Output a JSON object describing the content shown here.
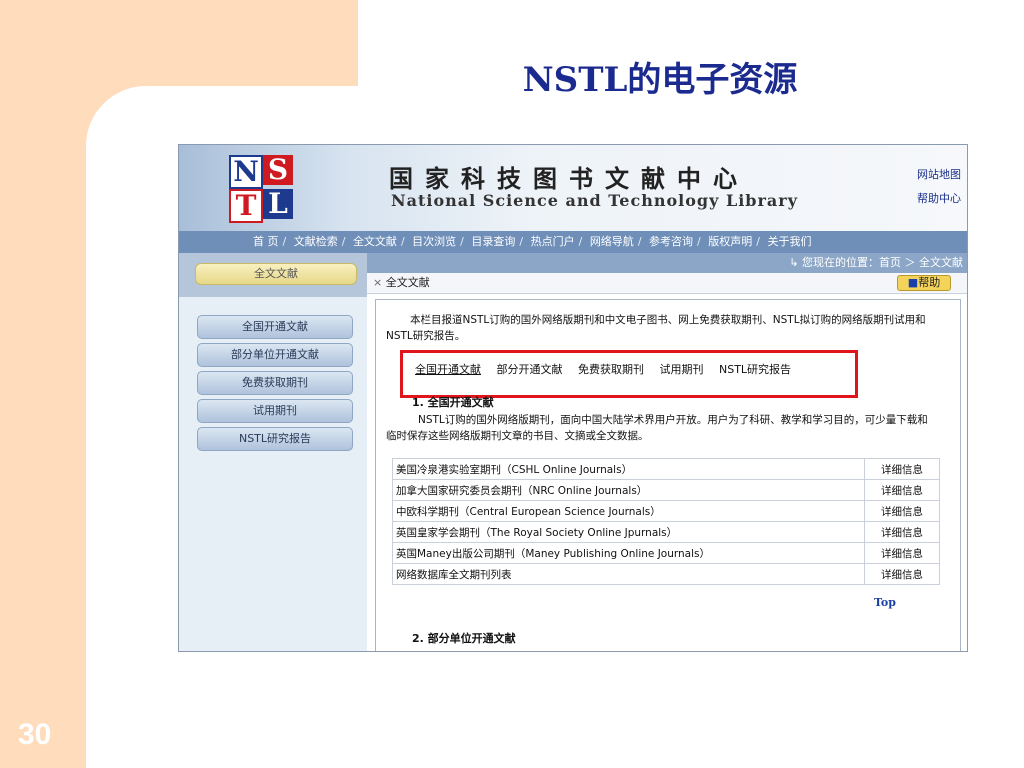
{
  "slide": {
    "title": "NSTL的电子资源",
    "page_number": "30"
  },
  "site": {
    "logo_letters": [
      "N",
      "S",
      "T",
      "L"
    ],
    "title_cn": "国家科技图书文献中心",
    "title_en": "National Science and Technology Library",
    "top_links": [
      "网站地图",
      "帮助中心"
    ],
    "nav": [
      "首 页",
      "文献检索",
      "全文文献",
      "目次浏览",
      "目录查询",
      "热点门户",
      "网络导航",
      "参考咨询",
      "版权声明",
      "关于我们"
    ]
  },
  "sidebar": {
    "active": "全文文献",
    "items": [
      "全国开通文献",
      "部分单位开通文献",
      "免费获取期刊",
      "试用期刊",
      "NSTL研究报告"
    ]
  },
  "main": {
    "location": "您现在的位置：首页 ＞ 全文文献",
    "crumb": "全文文献",
    "help_label": "帮助",
    "intro": "本栏目报道NSTL订购的国外网络版期刊和中文电子图书、网上免费获取期刊、NSTL拟订购的网络版期刊试用和NSTL研究报告。",
    "tabs": [
      "全国开通文献",
      "部分开通文献",
      "免费获取期刊",
      "试用期刊",
      "NSTL研究报告"
    ],
    "section1_title": "1. 全国开通文献",
    "section1_text": "NSTL订购的国外网络版期刊，面向中国大陆学术界用户开放。用户为了科研、教学和学习目的，可少量下载和临时保存这些网络版期刊文章的书目、文摘或全文数据。",
    "journals": [
      {
        "name": "美国冷泉港实验室期刊（CSHL Online Journals）",
        "detail": "详细信息"
      },
      {
        "name": "加拿大国家研究委员会期刊（NRC Online Journals）",
        "detail": "详细信息"
      },
      {
        "name": "中欧科学期刊（Central European Science Journals）",
        "detail": "详细信息"
      },
      {
        "name": "英国皇家学会期刊（The Royal Society Online Jpurnals）",
        "detail": "详细信息"
      },
      {
        "name": "英国Maney出版公司期刊（Maney Publishing Online Journals）",
        "detail": "详细信息"
      },
      {
        "name": "网络数据库全文期刊列表",
        "detail": "详细信息"
      }
    ],
    "top_label": "Top",
    "section2_title": "2. 部分单位开通文献"
  },
  "colors": {
    "slide_accent": "#ffdcbc",
    "title_color": "#1b2a8f",
    "highlight_border": "#e0151c",
    "nav_bar": "#6f8fb8"
  }
}
